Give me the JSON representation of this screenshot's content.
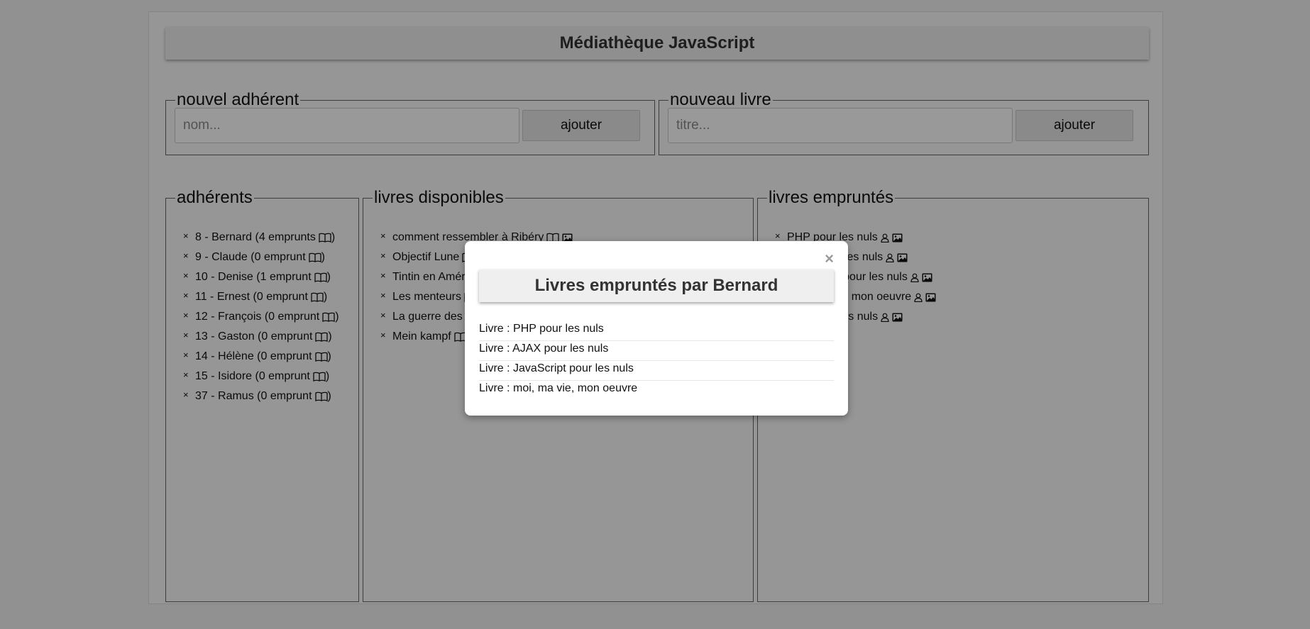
{
  "app": {
    "title": "Médiathèque JavaScript"
  },
  "new_member": {
    "legend": "nouvel adhérent",
    "placeholder": "nom...",
    "button": "ajouter"
  },
  "new_book": {
    "legend": "nouveau livre",
    "placeholder": "titre...",
    "button": "ajouter"
  },
  "members": {
    "legend": "adhérents",
    "items": [
      {
        "name": "8 - Bernard (4 emprunts",
        "suffix": ")"
      },
      {
        "name": "9 - Claude (0 emprunt",
        "suffix": ")"
      },
      {
        "name": "10 - Denise (1 emprunt",
        "suffix": ")"
      },
      {
        "name": "11 - Ernest (0 emprunt",
        "suffix": ")"
      },
      {
        "name": "12 - François (0 emprunt",
        "suffix": ")"
      },
      {
        "name": "13 - Gaston (0 emprunt",
        "suffix": ")"
      },
      {
        "name": "14 - Hélène (0 emprunt",
        "suffix": ")"
      },
      {
        "name": "15 - Isidore (0 emprunt",
        "suffix": ")"
      },
      {
        "name": "37 - Ramus (0 emprunt",
        "suffix": ")"
      }
    ]
  },
  "available_books": {
    "legend": "livres disponibles",
    "items": [
      {
        "title": "comment ressembler à Ribéry"
      },
      {
        "title": "Objectif Lune"
      },
      {
        "title": "Tintin en Amérique"
      },
      {
        "title": "Les menteurs"
      },
      {
        "title": "La guerre des"
      },
      {
        "title": "Mein kampf"
      }
    ]
  },
  "borrowed_books": {
    "legend": "livres empruntés",
    "items": [
      {
        "title": "PHP pour les nuls"
      },
      {
        "title": "AJAX pour les nuls"
      },
      {
        "title": "JavaScript pour les nuls"
      },
      {
        "title": "moi, ma vie, mon oeuvre"
      },
      {
        "title": "CSS pour les nuls"
      }
    ]
  },
  "modal": {
    "close": "×",
    "title": "Livres empruntés par Bernard",
    "items": [
      "Livre : PHP pour les nuls",
      "Livre : AJAX pour les nuls",
      "Livre : JavaScript pour les nuls",
      "Livre : moi, ma vie, mon oeuvre"
    ]
  },
  "icons": {
    "remove": "close-icon",
    "member_books": "open-book-icon",
    "lend": "open-book-icon",
    "cover": "image-icon",
    "borrower": "person-icon"
  }
}
